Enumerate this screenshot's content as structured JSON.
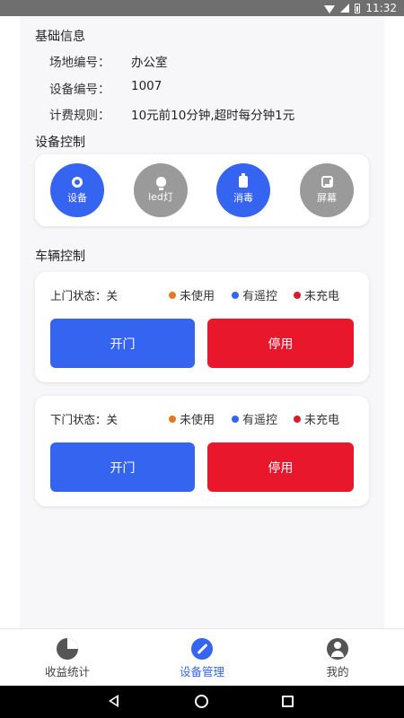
{
  "status_bar": {
    "time": "11:32"
  },
  "basic_info": {
    "title": "基础信息",
    "rows": [
      {
        "label": "场地编号：",
        "value": "办公室"
      },
      {
        "label": "设备编号：",
        "value": "1007"
      },
      {
        "label": "计费规则：",
        "value": "10元前10分钟,超时每分钟1元"
      }
    ]
  },
  "device_control": {
    "title": "设备控制",
    "buttons": [
      {
        "label": "设备",
        "icon": "gear-icon",
        "color": "#3564f0"
      },
      {
        "label": "led灯",
        "icon": "bulb-icon",
        "color": "#9a9a9a"
      },
      {
        "label": "消毒",
        "icon": "sanitizer-icon",
        "color": "#3564f0"
      },
      {
        "label": "屏幕",
        "icon": "screen-icon",
        "color": "#9a9a9a"
      }
    ]
  },
  "vehicle_control": {
    "title": "车辆控制",
    "legend": [
      {
        "label": "未使用",
        "color": "#e87722"
      },
      {
        "label": "有遥控",
        "color": "#3564f0"
      },
      {
        "label": "未充电",
        "color": "#d81b2c"
      }
    ],
    "doors": [
      {
        "state": "上门状态：关",
        "open_label": "开门",
        "stop_label": "停用"
      },
      {
        "state": "下门状态：关",
        "open_label": "开门",
        "stop_label": "停用"
      }
    ]
  },
  "tabbar": {
    "items": [
      {
        "label": "收益统计",
        "icon": "pie-chart-icon",
        "active": false
      },
      {
        "label": "设备管理",
        "icon": "wrench-icon",
        "active": true
      },
      {
        "label": "我的",
        "icon": "user-icon",
        "active": false
      }
    ]
  },
  "colors": {
    "primary": "#3564f0",
    "danger": "#e8172c",
    "background": "#f7f7f9"
  }
}
